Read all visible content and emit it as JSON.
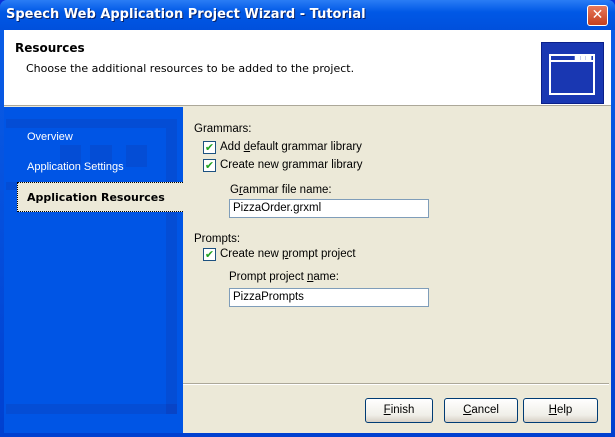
{
  "window": {
    "title": "Speech Web Application Project Wizard - Tutorial",
    "close_glyph": "✕"
  },
  "header": {
    "title": "Resources",
    "description": "Choose the additional resources to be added to the project.",
    "icon": "window-icon"
  },
  "sidebar": {
    "items": [
      {
        "label": "Overview"
      },
      {
        "label": "Application Settings"
      },
      {
        "label": "Application Resources",
        "selected": true
      }
    ]
  },
  "grammars": {
    "label": "Grammars:",
    "add_default": {
      "pre": "Add ",
      "key": "d",
      "post": "efault grammar library",
      "checked": true
    },
    "create_new": {
      "pre": "Create new ",
      "key": "g",
      "post": "rammar library",
      "checked": true
    },
    "file_label": {
      "pre": "G",
      "key": "r",
      "post": "ammar file name:"
    },
    "file_value": "PizzaOrder.grxml"
  },
  "prompts": {
    "label": "Prompts:",
    "create_new": {
      "pre": "Create new ",
      "key": "p",
      "post": "rompt project",
      "checked": true
    },
    "name_label": {
      "pre": "Prompt project ",
      "key": "n",
      "post": "ame:"
    },
    "name_value": "PizzaPrompts"
  },
  "buttons": {
    "finish": {
      "key": "F",
      "post": "inish"
    },
    "cancel": {
      "key": "C",
      "post": "ancel"
    },
    "help": {
      "key": "H",
      "post": "elp"
    }
  },
  "check_glyph": "✔"
}
